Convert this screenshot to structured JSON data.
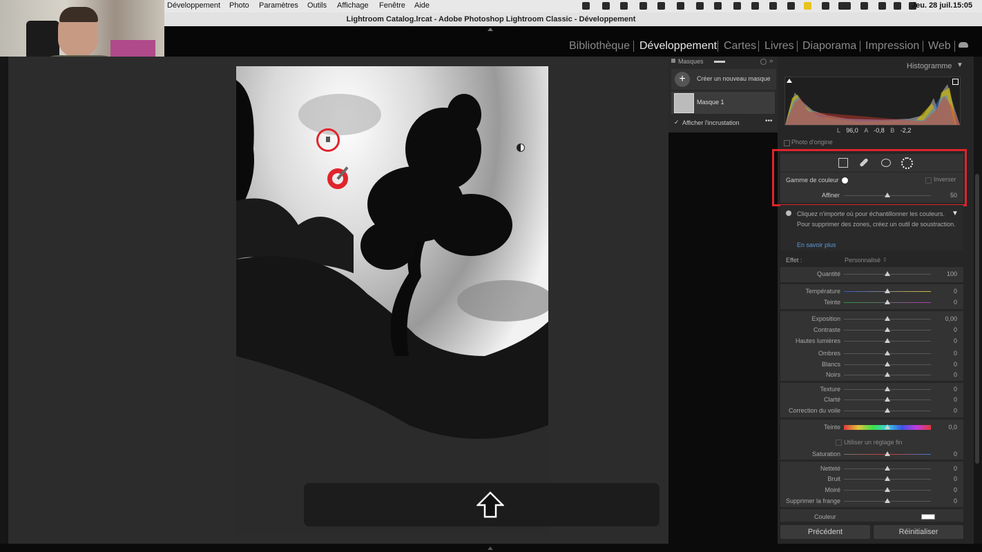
{
  "menubar": {
    "items": [
      "Développement",
      "Photo",
      "Paramètres",
      "Outils",
      "Affichage",
      "Fenêtre",
      "Aide"
    ],
    "date": "Jeu. 28 juil.",
    "time": "15:05"
  },
  "window": {
    "title": "Lightroom Catalog.lrcat - Adobe Photoshop Lightroom Classic - Développement"
  },
  "modules": [
    "Bibliothèque",
    "Développement",
    "Cartes",
    "Livres",
    "Diaporama",
    "Impression",
    "Web"
  ],
  "masks": {
    "title": "Masques",
    "create_label": "Créer un nouveau masque",
    "mask_name": "Masque 1",
    "overlay_label": "Afficher l'incrustation"
  },
  "histogram": {
    "title": "Histogramme",
    "readout": {
      "l_label": "L",
      "l": "96,0",
      "a_label": "A",
      "a": "-0,8",
      "b_label": "B",
      "b": "-2,2"
    },
    "original_label": "Photo d'origine"
  },
  "color_range": {
    "label": "Gamme de couleur",
    "invert_label": "Inverser",
    "refine_label": "Affiner",
    "refine_value": "50",
    "refine_level": 0.5,
    "hint_line1": "Cliquez n'importe où pour échantillonner les couleurs.",
    "hint_line2": "Pour supprimer des zones, créez un outil de soustraction.",
    "learn_more": "En savoir plus"
  },
  "effect": {
    "label": "Effet :",
    "preset": "Personnalisé"
  },
  "sliders": [
    {
      "label": "Quantité",
      "value": "100",
      "level": 0.5
    },
    {
      "label": "Température",
      "value": "0",
      "level": 0.5
    },
    {
      "label": "Teinte",
      "value": "0",
      "level": 0.5
    },
    {
      "label": "Exposition",
      "value": "0,00",
      "level": 0.5
    },
    {
      "label": "Contraste",
      "value": "0",
      "level": 0.5
    },
    {
      "label": "Hautes lumières",
      "value": "0",
      "level": 0.5
    },
    {
      "label": "Ombres",
      "value": "0",
      "level": 0.5
    },
    {
      "label": "Blancs",
      "value": "0",
      "level": 0.5
    },
    {
      "label": "Noirs",
      "value": "0",
      "level": 0.5
    },
    {
      "label": "Texture",
      "value": "0",
      "level": 0.5
    },
    {
      "label": "Clarté",
      "value": "0",
      "level": 0.5
    },
    {
      "label": "Correction du voile",
      "value": "0",
      "level": 0.5
    },
    {
      "label": "Teinte",
      "value": "0,0",
      "level": 0.5
    },
    {
      "label": "Saturation",
      "value": "0",
      "level": 0.5
    },
    {
      "label": "Netteté",
      "value": "0",
      "level": 0.5
    },
    {
      "label": "Bruit",
      "value": "0",
      "level": 0.5
    },
    {
      "label": "Moiré",
      "value": "0",
      "level": 0.5
    },
    {
      "label": "Supprimer la frange",
      "value": "0",
      "level": 0.5
    }
  ],
  "fine_tune_label": "Utiliser un réglage fin",
  "color_label": "Couleur",
  "buttons": {
    "previous": "Précédent",
    "reset": "Réinitialiser"
  },
  "colors": {
    "highlight_red": "#e0242b",
    "panel": "#262626",
    "accent_link": "#5a9ad8"
  }
}
